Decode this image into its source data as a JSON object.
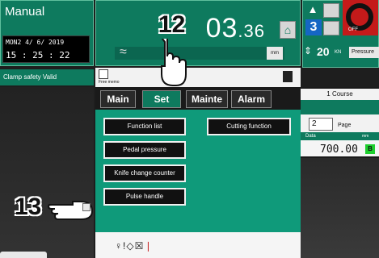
{
  "status": {
    "mode": "Manual",
    "date": "MON2 4/   6/ 2019",
    "time": "15 : 25 : 22",
    "clamp_safety": "Clamp safety  Valid"
  },
  "position": {
    "integer_part": "03",
    "decimal_part": ".36",
    "unit": "mm"
  },
  "right_panel": {
    "cut_count": "3",
    "off_label": "OFF",
    "pressure_value": "20",
    "pressure_unit": "KN",
    "pressure_label": "Pressure",
    "course": "1  Course",
    "page_number": "2",
    "page_label": "Page",
    "data_label": "Data",
    "data_unit": "mm",
    "data_value": "700.00",
    "data_badge": "B"
  },
  "memo": {
    "label": "Free memo"
  },
  "tabs": [
    {
      "label": "Main"
    },
    {
      "label": "Set"
    },
    {
      "label": "Mainte"
    },
    {
      "label": "Alarm"
    }
  ],
  "menu": {
    "function_list": "Function list",
    "cutting_function": "Cutting function",
    "pedal_pressure": "Pedal pressure",
    "knife_change_counter": "Knife change counter",
    "pulse_handle": "Pulse handle"
  },
  "callouts": {
    "set_tab": "12",
    "pulse_handle": "13"
  },
  "colors": {
    "panel_green": "#0e7a5e",
    "content_green": "#0f9a7a",
    "accent_blue": "#1566c4",
    "alert_red": "#c41a1a",
    "badge_green": "#1ecf2e"
  },
  "icons": [
    "home-icon",
    "knife-icon",
    "clamp-icon",
    "off-icon",
    "pressure-icon",
    "memo-icon",
    "hand-pointer-icon",
    "approx-icon"
  ]
}
